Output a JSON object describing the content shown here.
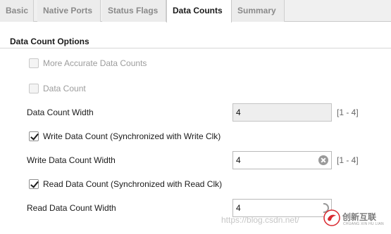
{
  "tabs": [
    {
      "label": "Basic",
      "active": false
    },
    {
      "label": "Native Ports",
      "active": false
    },
    {
      "label": "Status Flags",
      "active": false
    },
    {
      "label": "Data Counts",
      "active": true
    },
    {
      "label": "Summary",
      "active": false
    }
  ],
  "section": {
    "title": "Data Count Options"
  },
  "options": {
    "more_accurate": {
      "label": "More Accurate Data Counts",
      "checked": false,
      "enabled": false
    },
    "data_count": {
      "label": "Data Count",
      "checked": false,
      "enabled": false
    },
    "data_count_width": {
      "label": "Data Count Width",
      "value": "4",
      "range": "[1 - 4]"
    },
    "write_data_count": {
      "label": "Write Data Count (Synchronized with Write Clk)",
      "checked": true,
      "enabled": true
    },
    "write_data_count_width": {
      "label": "Write Data Count Width",
      "value": "4",
      "range": "[1 - 4]"
    },
    "read_data_count": {
      "label": "Read Data Count (Synchronized with Read Clk)",
      "checked": true,
      "enabled": true
    },
    "read_data_count_width": {
      "label": "Read Data Count Width",
      "value": "4"
    }
  },
  "watermark": {
    "url": "https://blog.csdn.net/",
    "brand": "创新互联",
    "sub": "CHUANG XIN HU LIAN"
  },
  "colors": {
    "active_tab_bg": "#ffffff",
    "tab_bar_bg": "#f0f0f0",
    "logo_red": "#d9282f"
  }
}
